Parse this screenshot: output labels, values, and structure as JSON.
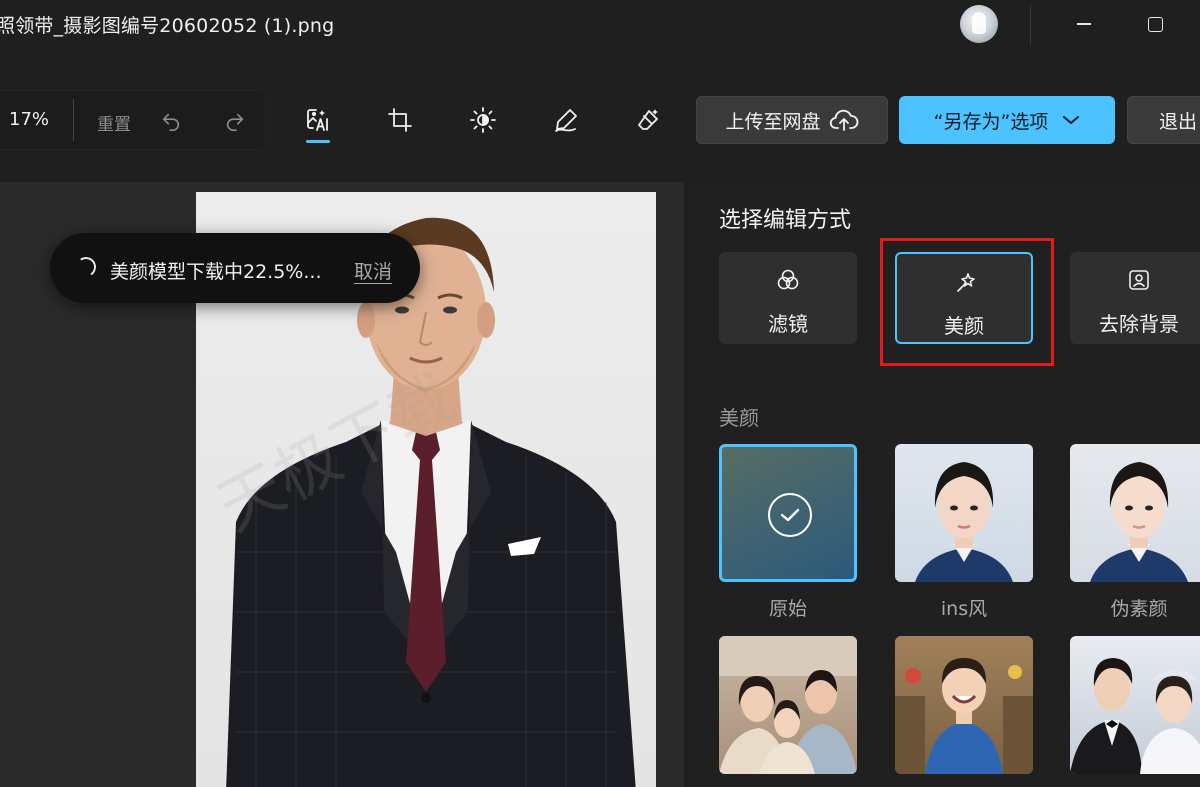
{
  "window": {
    "title": "照领带_摄影图编号20602052 (1).png"
  },
  "toolbar": {
    "zoom": "17%",
    "reset_label": "重置",
    "upload_label": "上传至网盘",
    "saveas_label": "“另存为”选项",
    "exit_label": "退出"
  },
  "toast": {
    "message": "美颜模型下载中22.5%...",
    "cancel": "取消"
  },
  "panel": {
    "title": "选择编辑方式",
    "modes": [
      {
        "label": "滤镜",
        "icon": "filter-icon"
      },
      {
        "label": "美颜",
        "icon": "beauty-icon",
        "selected": true
      },
      {
        "label": "去除背景",
        "icon": "remove-background-icon"
      }
    ],
    "section_label": "美颜",
    "effects": [
      {
        "label": "原始",
        "selected": true
      },
      {
        "label": "ins风"
      },
      {
        "label": "伪素颜"
      }
    ]
  },
  "canvas": {
    "watermark": "天极下载"
  },
  "colors": {
    "accent": "#4cc2ff",
    "highlight": "#e01b1b",
    "background": "#1f1f1f"
  }
}
